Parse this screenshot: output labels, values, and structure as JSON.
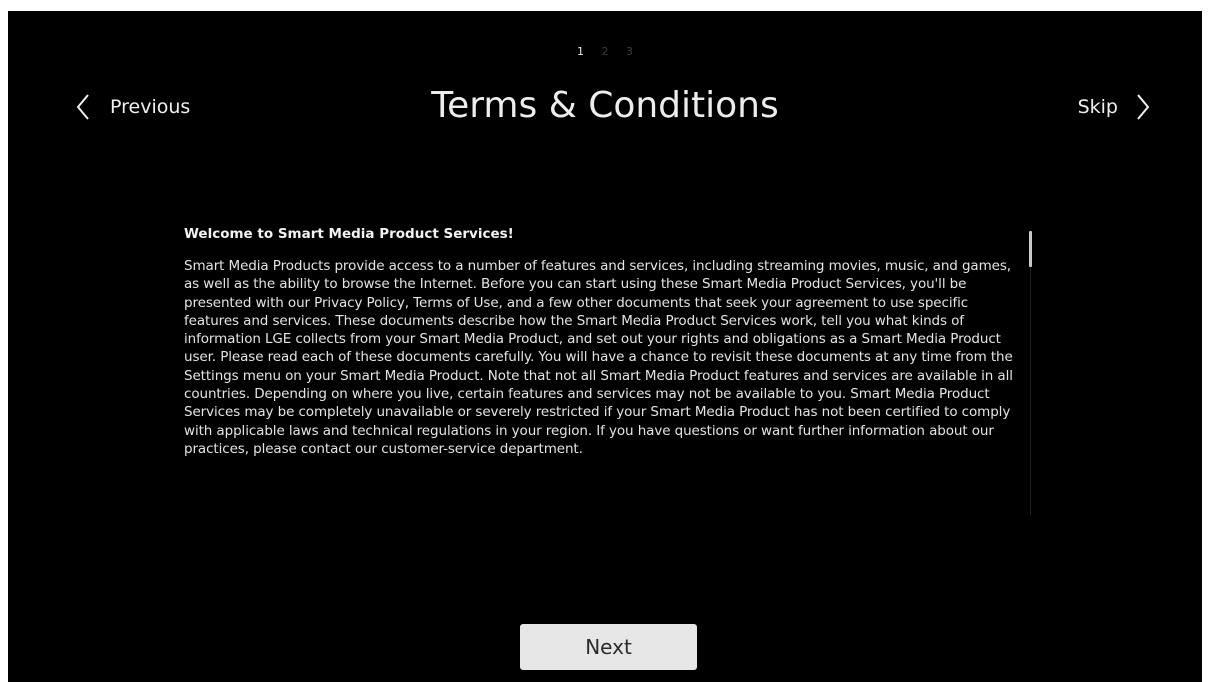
{
  "header": {
    "title": "Terms & Conditions",
    "steps": [
      "1",
      "2",
      "3"
    ],
    "active_step": 1,
    "previous_label": "Previous",
    "skip_label": "Skip"
  },
  "terms": {
    "heading": "Welcome to Smart Media Product Services!",
    "body": "Smart Media Products provide access to a number of features and services, including streaming movies, music, and games, as well as the ability to browse the Internet. Before you can start using these Smart Media Product Services, you'll be presented with our Privacy Policy, Terms of Use, and a few other documents that seek your agreement to use specific features and services. These documents describe how the Smart Media Product Services work, tell you what kinds of information LGE collects from your Smart Media Product, and set out your rights and obligations as a Smart Media Product user. Please read each of these documents carefully. You will have a chance to revisit these documents at any time from the Settings menu on your Smart Media Product. Note that not all Smart Media Product features and services are available in all countries. Depending on where you live, certain features and services may not be available to you. Smart Media Product Services may be completely unavailable or severely restricted if your Smart Media Product has not been certified to comply with applicable laws and technical regulations in your region. If you have questions or want further information about our practices, please contact our customer-service department."
  },
  "footer": {
    "next_label": "Next"
  },
  "colors": {
    "background": "#000000",
    "text": "#ffffff",
    "button_bg": "#e6e6e6",
    "inactive_step": "#3a3a3a"
  }
}
